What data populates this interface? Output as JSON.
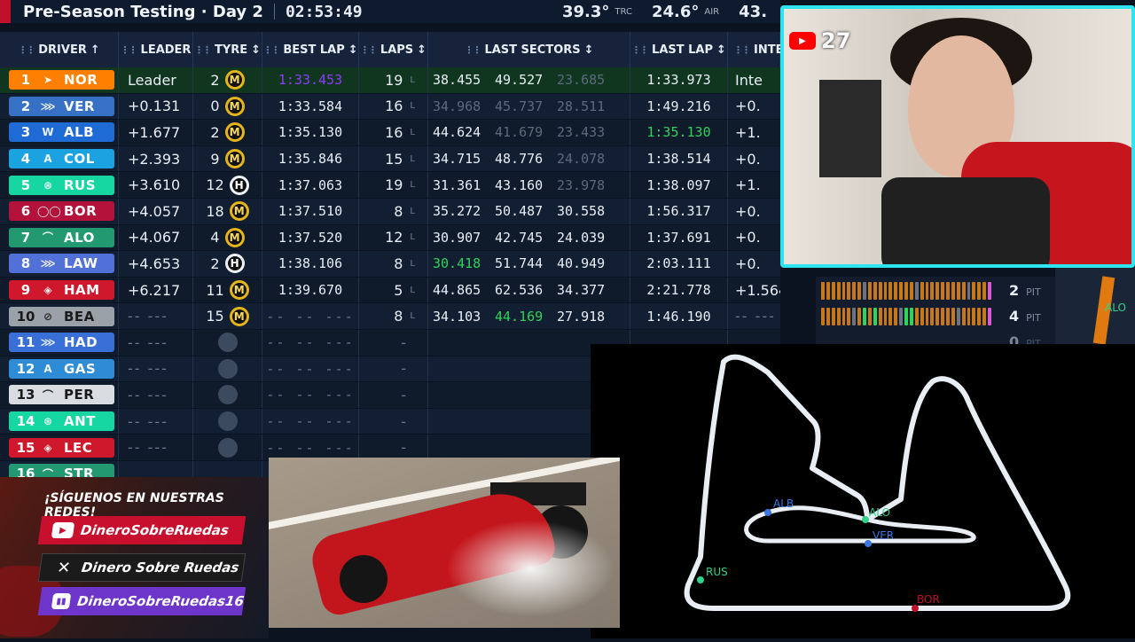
{
  "topbar": {
    "session": "Pre-Season Testing · Day 2",
    "clock": "02:53:49",
    "trc_value": "39.3°",
    "trc_label": "TRC",
    "air_value": "24.6°",
    "air_label": "AIR",
    "extra_value": "43."
  },
  "table": {
    "headers": {
      "driver": "DRIVER",
      "leader": "LEADER",
      "tyre": "TYRE",
      "best_lap": "BEST LAP",
      "laps": "LAPS",
      "last_sectors": "LAST SECTORS",
      "last_lap": "LAST LAP",
      "interval": "INTE"
    },
    "rows": [
      {
        "pos": "1",
        "code": "NOR",
        "team_color": "#ff8000",
        "leader": "Leader",
        "tyre_age": "2",
        "tyre": "M",
        "best": "1:33.453",
        "laps": "19",
        "laps_tag": "L",
        "s1": "38.455",
        "s2": "49.527",
        "s3": "23.685",
        "last": "1:33.973",
        "interval": "Inte"
      },
      {
        "pos": "2",
        "code": "VER",
        "team_color": "#3671c6",
        "leader": "+0.131",
        "tyre_age": "0",
        "tyre": "M",
        "best": "1:33.584",
        "laps": "16",
        "laps_tag": "L",
        "s1": "34.968",
        "s2": "45.737",
        "s3": "28.511",
        "last": "1:49.216",
        "interval": "+0."
      },
      {
        "pos": "3",
        "code": "ALB",
        "team_color": "#1f6bd6",
        "leader": "+1.677",
        "tyre_age": "2",
        "tyre": "M",
        "best": "1:35.130",
        "laps": "16",
        "laps_tag": "L",
        "s1": "44.624",
        "s2": "41.679",
        "s3": "23.433",
        "last": "1:35.130",
        "interval": "+1."
      },
      {
        "pos": "4",
        "code": "COL",
        "team_color": "#1aa3e0",
        "leader": "+2.393",
        "tyre_age": "9",
        "tyre": "M",
        "best": "1:35.846",
        "laps": "15",
        "laps_tag": "L",
        "s1": "34.715",
        "s2": "48.776",
        "s3": "24.078",
        "last": "1:38.514",
        "interval": "+0."
      },
      {
        "pos": "5",
        "code": "RUS",
        "team_color": "#16d6a1",
        "leader": "+3.610",
        "tyre_age": "12",
        "tyre": "H",
        "best": "1:37.063",
        "laps": "19",
        "laps_tag": "L",
        "s1": "31.361",
        "s2": "43.160",
        "s3": "23.978",
        "last": "1:38.097",
        "interval": "+1."
      },
      {
        "pos": "6",
        "code": "BOR",
        "team_color": "#b3123a",
        "leader": "+4.057",
        "tyre_age": "18",
        "tyre": "M",
        "best": "1:37.510",
        "laps": "8",
        "laps_tag": "L",
        "s1": "35.272",
        "s2": "50.487",
        "s3": "30.558",
        "last": "1:56.317",
        "interval": "+0."
      },
      {
        "pos": "7",
        "code": "ALO",
        "team_color": "#229971",
        "leader": "+4.067",
        "tyre_age": "4",
        "tyre": "M",
        "best": "1:37.520",
        "laps": "12",
        "laps_tag": "L",
        "s1": "30.907",
        "s2": "42.745",
        "s3": "24.039",
        "last": "1:37.691",
        "interval": "+0."
      },
      {
        "pos": "8",
        "code": "LAW",
        "team_color": "#5170d8",
        "leader": "+4.653",
        "tyre_age": "2",
        "tyre": "H",
        "best": "1:38.106",
        "laps": "8",
        "laps_tag": "L",
        "s1": "30.418",
        "s2": "51.744",
        "s3": "40.949",
        "last": "2:03.111",
        "interval": "+0."
      },
      {
        "pos": "9",
        "code": "HAM",
        "team_color": "#d0182c",
        "leader": "+6.217",
        "tyre_age": "11",
        "tyre": "M",
        "best": "1:39.670",
        "laps": "5",
        "laps_tag": "L",
        "s1": "44.865",
        "s2": "62.536",
        "s3": "34.377",
        "last": "2:21.778",
        "interval": "+1.564"
      },
      {
        "pos": "10",
        "code": "BEA",
        "team_color": "#9aa1a8",
        "leader": "-- ---",
        "tyre_age": "15",
        "tyre": "M",
        "best": "-- -- ---",
        "laps": "8",
        "laps_tag": "L",
        "s1": "34.103",
        "s2": "44.169",
        "s3": "27.918",
        "last": "1:46.190",
        "interval": "-- ---"
      },
      {
        "pos": "11",
        "code": "HAD",
        "team_color": "#3a6fd8",
        "leader": "-- ---",
        "tyre_age": "",
        "tyre": "",
        "best": "-- -- ---",
        "laps": "-",
        "laps_tag": "",
        "s1": "",
        "s2": "",
        "s3": "",
        "last": "",
        "interval": ""
      },
      {
        "pos": "12",
        "code": "GAS",
        "team_color": "#2e8bd6",
        "leader": "-- ---",
        "tyre_age": "",
        "tyre": "",
        "best": "-- -- ---",
        "laps": "-",
        "laps_tag": "",
        "s1": "",
        "s2": "",
        "s3": "",
        "last": "",
        "interval": ""
      },
      {
        "pos": "13",
        "code": "PER",
        "team_color": "#d9dde2",
        "leader": "-- ---",
        "tyre_age": "",
        "tyre": "",
        "best": "-- -- ---",
        "laps": "-",
        "laps_tag": "",
        "s1": "",
        "s2": "",
        "s3": "",
        "last": "",
        "interval": ""
      },
      {
        "pos": "14",
        "code": "ANT",
        "team_color": "#16d6a1",
        "leader": "-- ---",
        "tyre_age": "",
        "tyre": "",
        "best": "-- -- ---",
        "laps": "-",
        "laps_tag": "",
        "s1": "",
        "s2": "",
        "s3": "",
        "last": "",
        "interval": ""
      },
      {
        "pos": "15",
        "code": "LEC",
        "team_color": "#d0182c",
        "leader": "-- ---",
        "tyre_age": "",
        "tyre": "",
        "best": "-- -- ---",
        "laps": "-",
        "laps_tag": "",
        "s1": "",
        "s2": "",
        "s3": "",
        "last": "",
        "interval": ""
      },
      {
        "pos": "16",
        "code": "STR",
        "team_color": "#229971",
        "leader": "",
        "tyre_age": "",
        "tyre": "",
        "best": "",
        "laps": "",
        "laps_tag": "",
        "s1": "",
        "s2": "",
        "s3": "",
        "last": "",
        "interval": ""
      }
    ]
  },
  "webcam": {
    "viewer_count": "27"
  },
  "pit_strip": [
    {
      "count": "2",
      "label": "PIT"
    },
    {
      "count": "4",
      "label": "PIT"
    },
    {
      "count": "0",
      "label": "PIT"
    }
  ],
  "right_panel_tag": "ALO",
  "track_map": {
    "labels": [
      {
        "code": "ALB",
        "color": "#3a78e0"
      },
      {
        "code": "ALO",
        "color": "#2fd38a"
      },
      {
        "code": "VER",
        "color": "#3a78e0"
      },
      {
        "code": "RUS",
        "color": "#2fd38a"
      },
      {
        "code": "BOR",
        "color": "#c0102a"
      }
    ]
  },
  "social": {
    "title": "¡SÍGUENOS EN NUESTRAS REDES!",
    "youtube": "DineroSobreRuedas",
    "x": "Dinero Sobre Ruedas",
    "twitch": "DineroSobreRuedas16"
  }
}
